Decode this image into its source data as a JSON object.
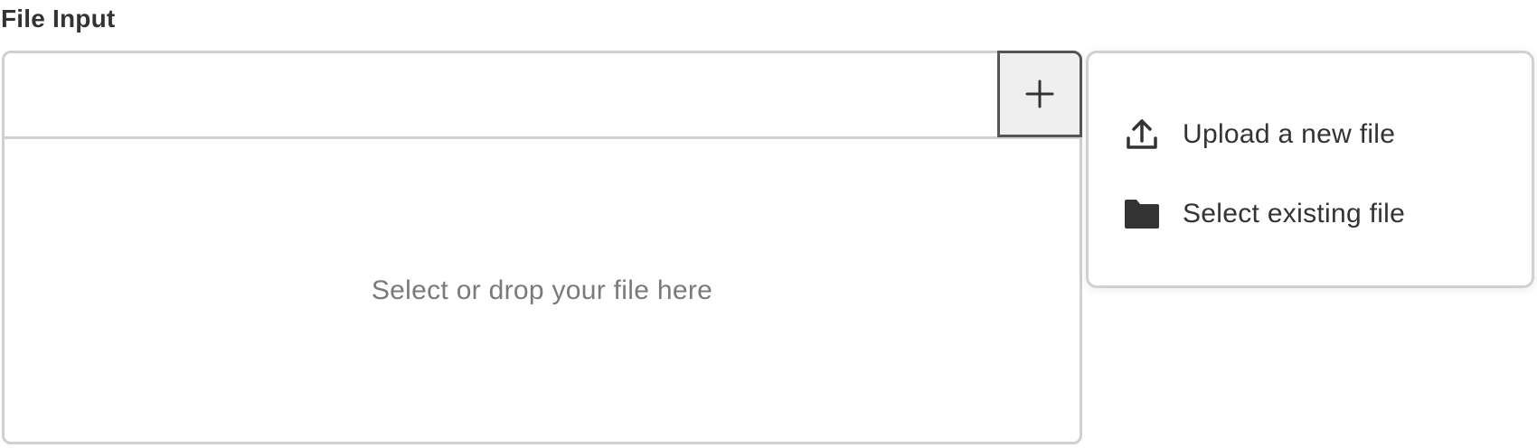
{
  "field": {
    "label": "File Input",
    "drop_text": "Select or drop your file here",
    "add_icon": "plus-icon"
  },
  "menu": {
    "items": [
      {
        "label": "Upload a new file",
        "icon": "upload-icon"
      },
      {
        "label": "Select existing file",
        "icon": "folder-icon"
      }
    ]
  },
  "colors": {
    "border": "#d0d0d0",
    "active_border": "#555555",
    "button_bg": "#efefef",
    "text": "#333333",
    "placeholder": "#7a7a7a"
  }
}
